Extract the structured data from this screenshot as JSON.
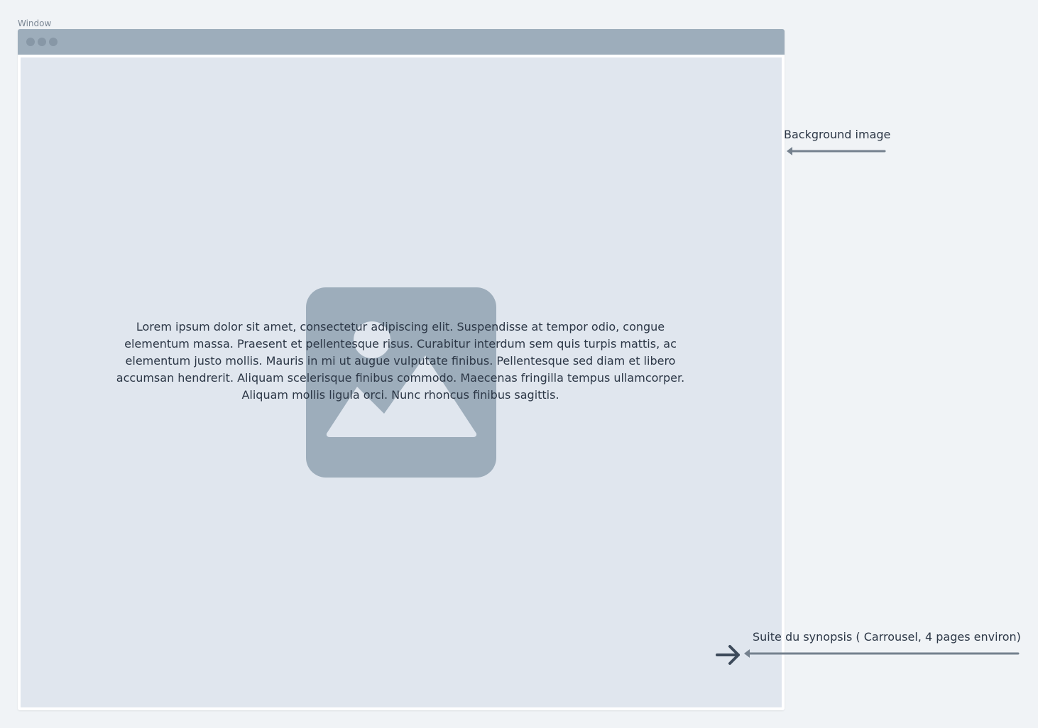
{
  "window": {
    "caption": "Window"
  },
  "content": {
    "background_placeholder_icon": "image-placeholder-icon",
    "synopsis_lines": [
      "Lorem ipsum dolor sit amet, consectetur adipiscing elit. Suspendisse at  tempor odio, congue",
      "elementum massa. Praesent et pellentesque risus.  Curabitur interdum sem quis turpis mattis, ac",
      "elementum justo mollis.  Mauris in mi ut augue vulputate finibus. Pellentesque sed diam et libero",
      "accumsan hendrerit. Aliquam scelerisque finibus commodo. Maecenas  fringilla tempus ullamcorper.",
      "Aliquam mollis ligula orci. Nunc rhoncus  finibus sagittis."
    ],
    "next_icon": "arrow-right-icon"
  },
  "annotations": {
    "background_image": "Background image",
    "synopsis_next": "Suite du synopsis ( Carrousel, 4 pages environ)"
  },
  "colors": {
    "page_background": "#f0f3f6",
    "titlebar": "#9dadbb",
    "content_background": "#e0e6ee",
    "placeholder": "#9dadbb",
    "text": "#2c3746",
    "annotation_line": "#75818e"
  }
}
